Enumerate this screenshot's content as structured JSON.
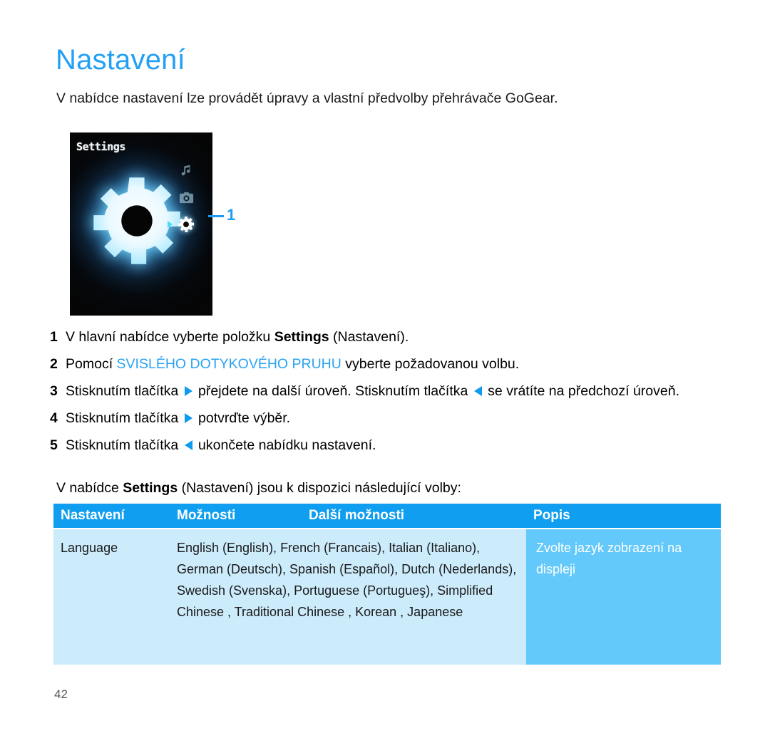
{
  "page": {
    "title": "Nastavení",
    "intro": "V nabídce nastavení lze provádět úpravy a vlastní předvolby přehrávače GoGear.",
    "page_number": "42",
    "accent_color": "#22A0F5",
    "header_bar_color": "#0F9EF0",
    "cell_light_color": "#CCEBFB",
    "cell_dark_color": "#63C8FA"
  },
  "device_screen": {
    "title": "Settings",
    "callout_number": "1",
    "icons": [
      {
        "name": "music-note-icon",
        "state": "dim"
      },
      {
        "name": "camera-icon",
        "state": "dim"
      },
      {
        "name": "gear-icon",
        "state": "selected"
      }
    ],
    "main_icon": "gear-icon"
  },
  "steps": [
    {
      "number": "1",
      "parts": [
        {
          "text": "V hlavní nabídce vyberte položku ",
          "style": "normal"
        },
        {
          "text": "Settings",
          "style": "bold"
        },
        {
          "text": " (Nastavení).",
          "style": "normal"
        }
      ]
    },
    {
      "number": "2",
      "parts": [
        {
          "text": "Pomocí ",
          "style": "normal"
        },
        {
          "text": "SVISLÉHO DOTYKOVÉHO PRUHU",
          "style": "blue"
        },
        {
          "text": " vyberte požadovanou volbu.",
          "style": "normal"
        }
      ]
    },
    {
      "number": "3",
      "parts": [
        {
          "text": "Stisknutím tlačítka ",
          "style": "normal"
        },
        {
          "text": "▶",
          "style": "tri-right"
        },
        {
          "text": " přejdete na další úroveň. Stisknutím tlačítka ",
          "style": "normal"
        },
        {
          "text": "◀",
          "style": "tri-left"
        },
        {
          "text": " se vrátíte na předchozí úroveň.",
          "style": "normal"
        }
      ]
    },
    {
      "number": "4",
      "parts": [
        {
          "text": "Stisknutím tlačítka ",
          "style": "normal"
        },
        {
          "text": "▶",
          "style": "tri-right"
        },
        {
          "text": " potvrďte výběr.",
          "style": "normal"
        }
      ]
    },
    {
      "number": "5",
      "parts": [
        {
          "text": "Stisknutím tlačítka ",
          "style": "normal"
        },
        {
          "text": "◀",
          "style": "tri-left"
        },
        {
          "text": " ukončete nabídku nastavení.",
          "style": "normal"
        }
      ]
    }
  ],
  "lead_line": {
    "before": "V nabídce ",
    "bold": "Settings",
    "after": " (Nastavení) jsou k dispozici následující volby:"
  },
  "table": {
    "headers": {
      "setting": "Nastavení",
      "options": "Možnosti",
      "more_options": "Další možnosti",
      "description": "Popis"
    },
    "rows": [
      {
        "setting": "Language",
        "options": "English (English), French (Francais), Italian (Italiano), German (Deutsch), Spanish (Español), Dutch (Nederlands), Swedish (Svenska), Portuguese (Portugueş), Simplified Chinese , Traditional Chinese , Korean , Japanese",
        "description": "Zvolte jazyk zobrazení na displeji"
      }
    ]
  }
}
